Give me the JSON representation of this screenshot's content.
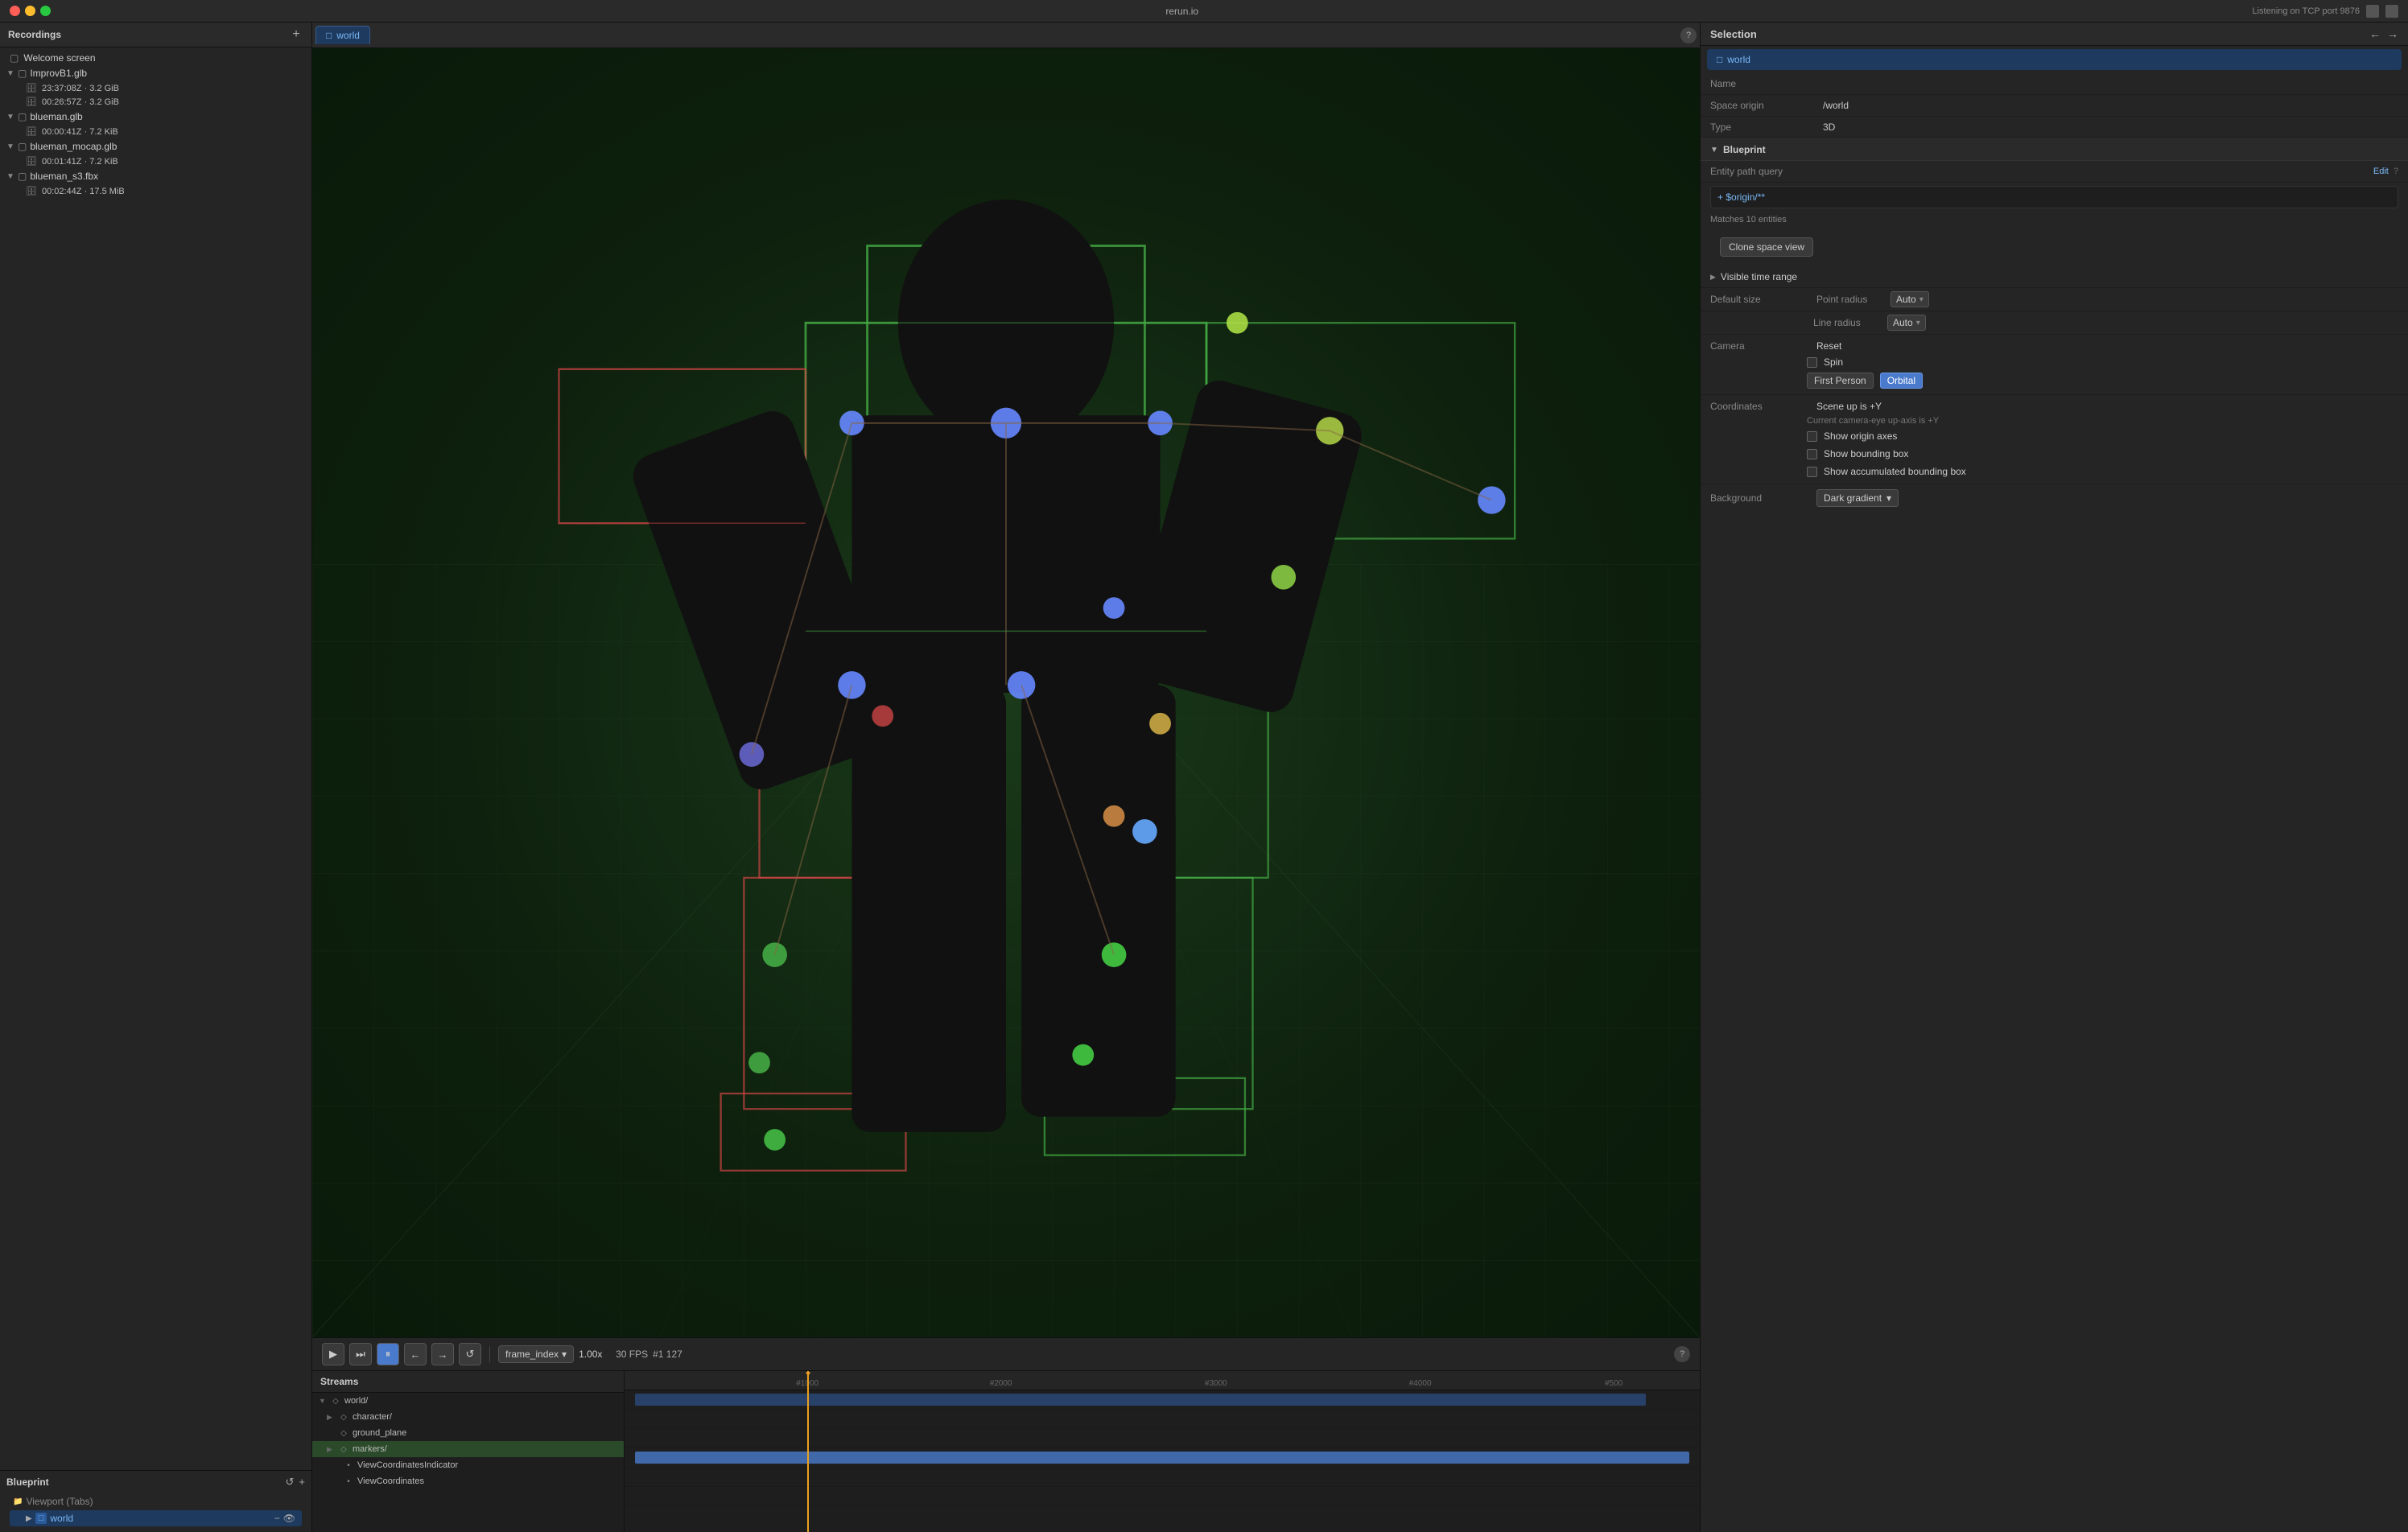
{
  "app": {
    "title": "rerun.io",
    "listening": "Listening on TCP port 9876"
  },
  "titlebar": {
    "buttons": [
      "close",
      "minimize",
      "maximize"
    ],
    "help_icon": "?",
    "monitor_icons": [
      "monitor",
      "window"
    ]
  },
  "recordings": {
    "title": "Recordings",
    "add_label": "+",
    "welcome_screen": "Welcome screen",
    "groups": [
      {
        "name": "ImprovB1.glb",
        "entries": [
          "23:37:08Z · 3.2 GiB",
          "00:26:57Z · 3.2 GiB"
        ]
      },
      {
        "name": "blueman.glb",
        "entries": [
          "00:00:41Z · 7.2 KiB"
        ]
      },
      {
        "name": "blueman_mocap.glb",
        "entries": [
          "00:01:41Z · 7.2 KiB"
        ]
      },
      {
        "name": "blueman_s3.fbx",
        "entries": [
          "00:02:44Z · 17.5 MiB"
        ]
      }
    ]
  },
  "blueprint": {
    "title": "Blueprint",
    "refresh_icon": "↺",
    "add_icon": "+",
    "viewport_tabs_label": "Viewport (Tabs)",
    "world_tab_label": "world",
    "world_tab_icon": "□"
  },
  "viewport": {
    "tab_label": "world",
    "tab_icon": "□",
    "help_icon": "?"
  },
  "playback": {
    "play_icon": "▶",
    "step_forward_icon": "⏭",
    "pause_icon": "⏸",
    "arrow_left_icon": "←",
    "arrow_right_icon": "→",
    "loop_icon": "↺",
    "frame_label": "frame_index",
    "speed": "1.00x",
    "fps": "30 FPS",
    "frame": "#1 127",
    "help_icon": "?"
  },
  "streams": {
    "title": "Streams",
    "items": [
      {
        "level": 0,
        "name": "world/",
        "has_children": true,
        "icon": "◇",
        "expandable": true
      },
      {
        "level": 1,
        "name": "character/",
        "has_children": true,
        "icon": "◇",
        "expandable": true
      },
      {
        "level": 1,
        "name": "ground_plane",
        "has_children": false,
        "icon": "◇",
        "expandable": false
      },
      {
        "level": 1,
        "name": "markers/",
        "has_children": true,
        "icon": "◇",
        "expandable": true
      },
      {
        "level": 2,
        "name": "ViewCoordinatesIndicator",
        "has_children": false,
        "icon": "•",
        "expandable": false
      },
      {
        "level": 2,
        "name": "ViewCoordinates",
        "has_children": false,
        "icon": "•",
        "expandable": false
      }
    ]
  },
  "timeline": {
    "markers": [
      "#1000",
      "#2000",
      "#3000",
      "#4000",
      "#500"
    ],
    "playhead_pos_pct": 17
  },
  "selection": {
    "title": "Selection",
    "nav_back": "←",
    "nav_forward": "→",
    "close_icon": "×",
    "world_tab_label": "world",
    "properties": [
      {
        "label": "Name",
        "value": ""
      },
      {
        "label": "Space origin",
        "value": "/world"
      },
      {
        "label": "Type",
        "value": "3D"
      }
    ],
    "blueprint_section": {
      "title": "Blueprint",
      "entity_path_label": "Entity path query",
      "edit_label": "Edit",
      "help_icon": "?",
      "query_value": "+ $origin/**",
      "matches_text": "Matches 10 entities",
      "clone_label": "Clone space view"
    },
    "visible_time_range": {
      "label": "Visible time range"
    },
    "default_size": {
      "label": "Default size",
      "point_radius_label": "Point radius",
      "point_radius_value": "Auto",
      "line_radius_label": "Line radius",
      "line_radius_value": "Auto"
    },
    "camera": {
      "label": "Camera",
      "reset_label": "Reset",
      "spin_label": "Spin",
      "first_person_label": "First Person",
      "orbital_label": "Orbital"
    },
    "coordinates": {
      "label": "Coordinates",
      "value": "Scene up is +Y",
      "note": "Current camera-eye up-axis is +Y",
      "checkboxes": [
        {
          "label": "Show origin axes",
          "checked": false
        },
        {
          "label": "Show bounding box",
          "checked": false
        },
        {
          "label": "Show accumulated bounding box",
          "checked": false
        }
      ]
    },
    "background": {
      "label": "Background",
      "value": "Dark gradient"
    }
  }
}
